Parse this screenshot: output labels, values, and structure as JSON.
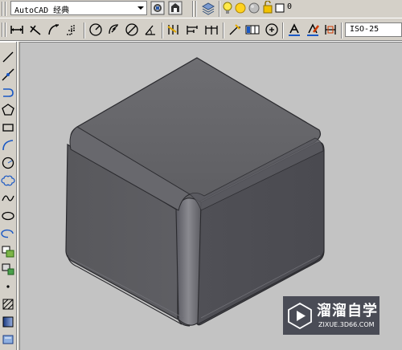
{
  "toolbar_top": {
    "workspace_selected": "AutoCAD 经典",
    "layer_current": "0",
    "icons": [
      "workspace-settings-icon",
      "workspace-save-icon",
      "layer-manager-icon",
      "lightbulb-icon",
      "sun-icon",
      "layer-color-icon",
      "lock-icon",
      "layer-color-square-icon"
    ]
  },
  "toolbar_dim": {
    "icons": [
      "linear-dimension-icon",
      "aligned-dimension-icon",
      "arc-length-icon",
      "ordinate-dimension-icon",
      "radius-dimension-icon",
      "jogged-dimension-icon",
      "diameter-dimension-icon",
      "angular-dimension-icon",
      "quick-dimension-icon",
      "baseline-dimension-icon",
      "continue-dimension-icon",
      "quick-leader-icon",
      "tolerance-icon",
      "center-mark-icon",
      "dimension-edit-icon",
      "dimension-text-edit-icon",
      "dimension-update-icon"
    ],
    "dimstyle_selected": "ISO-25"
  },
  "toolbar_draw": {
    "icons": [
      "line-icon",
      "construction-line-icon",
      "polyline-icon",
      "polygon-icon",
      "rectangle-icon",
      "arc-icon",
      "circle-icon",
      "revision-cloud-icon",
      "spline-icon",
      "ellipse-icon",
      "ellipse-arc-icon",
      "insert-block-icon",
      "make-block-icon",
      "point-icon",
      "hatch-icon",
      "gradient-icon",
      "region-icon"
    ]
  },
  "canvas": {
    "background": "#c3c3c3",
    "object": "filleted-cube"
  },
  "watermark": {
    "title": "溜溜自学",
    "subtitle": "ZIXUE.3D66.COM"
  }
}
